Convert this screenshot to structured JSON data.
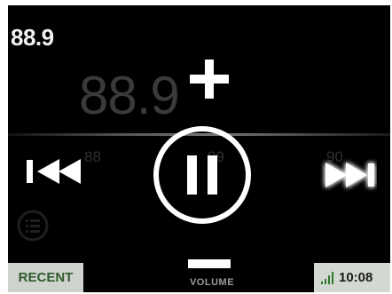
{
  "station": {
    "frequency_small": "88.9",
    "frequency_large": "88.9",
    "dial_ticks": [
      "88",
      "89",
      "90"
    ]
  },
  "controls": {
    "volume_label": "VOLUME",
    "recent_label": "RECENT",
    "state": "playing"
  },
  "status": {
    "time": "10:08"
  },
  "icons": {
    "volume_up": "plus-icon",
    "volume_down": "minus-icon",
    "previous": "skip-previous-icon",
    "next": "skip-next-icon",
    "play_pause": "pause-icon",
    "list": "list-icon",
    "signal": "signal-bars-icon"
  },
  "colors": {
    "panel_background": "#000000",
    "foreground": "#ffffff",
    "recent_text": "#2f5a2c",
    "footer_background": "#cfd3cd"
  }
}
